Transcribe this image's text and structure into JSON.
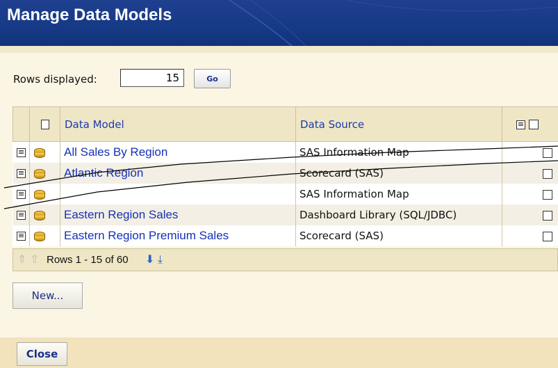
{
  "header": {
    "title": "Manage Data Models"
  },
  "rows": {
    "label": "Rows displayed:",
    "value": "15",
    "go_label": "Go"
  },
  "table": {
    "columns": {
      "data_model": "Data Model",
      "data_source": "Data Source"
    },
    "rows": [
      {
        "model": "All Sales By Region",
        "source": "SAS Information Map"
      },
      {
        "model": "Atlantic Region",
        "source": "Scorecard (SAS)"
      },
      {
        "model": "",
        "source": "SAS Information Map"
      },
      {
        "model": "Eastern Region Sales",
        "source": "Dashboard Library (SQL/JDBC)"
      },
      {
        "model": "Eastern Region Premium Sales",
        "source": "Scorecard (SAS)"
      }
    ]
  },
  "pager": {
    "text": "Rows 1 - 15 of 60"
  },
  "buttons": {
    "new_label": "New...",
    "close_label": "Close"
  },
  "colors": {
    "header": "#163a86",
    "link": "#1531b8",
    "background": "#fbf5e3"
  }
}
